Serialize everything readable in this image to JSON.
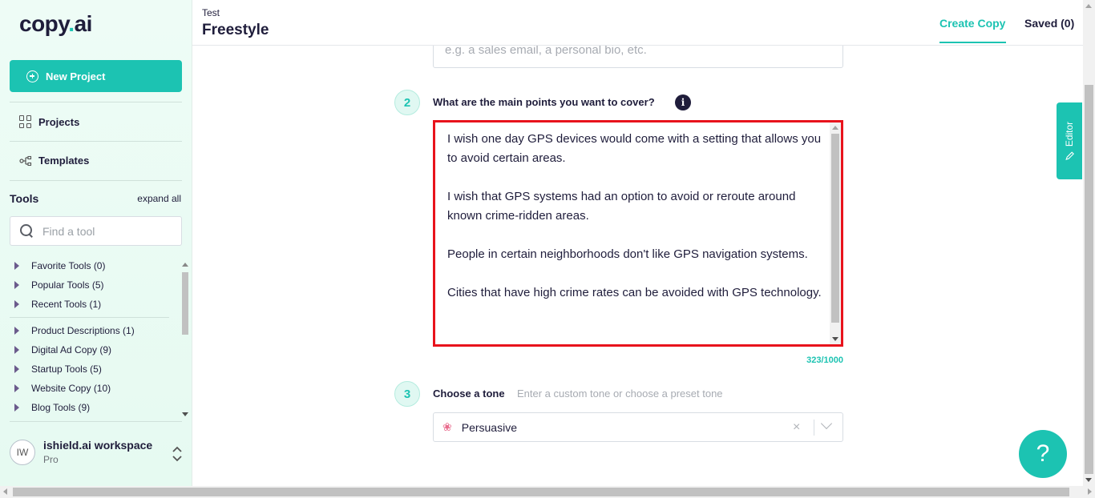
{
  "colors": {
    "accent": "#1cc3b2",
    "text": "#1f1d3b",
    "highlight_border": "#e8131c"
  },
  "sidebar": {
    "logo_main": "copy",
    "logo_dot": ".",
    "logo_suffix": "ai",
    "new_project_label": "New Project",
    "projects_label": "Projects",
    "templates_label": "Templates",
    "tools_heading": "Tools",
    "expand_all_label": "expand all",
    "search_placeholder": "Find a tool",
    "tool_groups": [
      {
        "label": "Favorite Tools (0)"
      },
      {
        "label": "Popular Tools (5)"
      },
      {
        "label": "Recent Tools (1)"
      }
    ],
    "tool_categories": [
      {
        "label": "Product Descriptions (1)"
      },
      {
        "label": "Digital Ad Copy (9)"
      },
      {
        "label": "Startup Tools (5)"
      },
      {
        "label": "Website Copy (10)"
      },
      {
        "label": "Blog Tools (9)"
      }
    ],
    "workspace": {
      "initials": "IW",
      "name": "ishield.ai workspace",
      "plan": "Pro"
    }
  },
  "header": {
    "breadcrumb": "Test",
    "title": "Freestyle",
    "tabs": [
      {
        "label": "Create Copy",
        "active": true
      },
      {
        "label": "Saved (0)",
        "active": false
      }
    ]
  },
  "form": {
    "step1": {
      "placeholder": "e.g. a sales email, a personal bio, etc."
    },
    "step2": {
      "number": "2",
      "label": "What are the main points you want to cover?",
      "info_icon": "i",
      "value": "I wish one day GPS devices would come with a setting that allows you to avoid certain areas.\n\nI wish that GPS systems had an option to avoid or reroute around known crime-ridden areas.\n\nPeople in certain neighborhoods don't like GPS navigation systems.\n\nCities that have high crime rates can be avoided with GPS technology.",
      "counter": "323/1000"
    },
    "step3": {
      "number": "3",
      "label": "Choose a tone",
      "hint": "Enter a custom tone or choose a preset tone",
      "icon": "brain-icon",
      "selected": "Persuasive",
      "clear_label": "×"
    }
  },
  "editor_tab": {
    "label": "Editor"
  },
  "help_button": {
    "label": "?"
  }
}
